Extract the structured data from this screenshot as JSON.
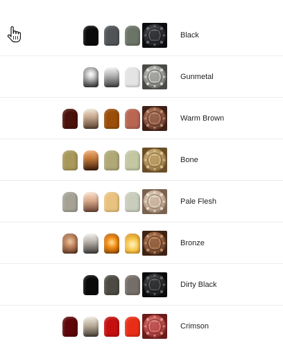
{
  "cursor": {
    "icon": "hand-pointer-icon"
  },
  "schemes": [
    {
      "name": "Black",
      "pots": [
        "#0b0b0b",
        "#505457",
        "#6b7467"
      ],
      "swatch": {
        "base": "#2b2d30",
        "light": "#7a7e84",
        "dark": "#0c0c0e"
      }
    },
    {
      "name": "Gunmetal",
      "pots": [
        "metallic-silver",
        "metallic-chrome",
        "#e4e4e4"
      ],
      "swatch": {
        "base": "#9a9a96",
        "light": "#ecece8",
        "dark": "#4a4a46"
      }
    },
    {
      "name": "Warm Brown",
      "pots": [
        "#4a120a",
        "tan-gradient",
        "#9a4e0a",
        "#b86552"
      ],
      "swatch": {
        "base": "#8e5a44",
        "light": "#d59c7e",
        "dark": "#3e2016"
      }
    },
    {
      "name": "Bone",
      "pots": [
        "#a8985a",
        "copper-gradient",
        "#b0a877",
        "#c3c7a2"
      ],
      "swatch": {
        "base": "#b4945e",
        "light": "#ead2a0",
        "dark": "#6a4e28"
      }
    },
    {
      "name": "Pale Flesh",
      "pots": [
        "#a5a295",
        "flesh-gradient",
        "#e9c27f",
        "#c9cdbb"
      ],
      "swatch": {
        "base": "#c8b09a",
        "light": "#f4ebdf",
        "dark": "#7a6250"
      }
    },
    {
      "name": "Bronze",
      "pots": [
        "bronze-gradient",
        "steel-gradient",
        "orange-gradient",
        "gold-gradient"
      ],
      "swatch": {
        "base": "#8e5c3c",
        "light": "#d8a278",
        "dark": "#3e2414"
      }
    },
    {
      "name": "Dirty Black",
      "pots": [
        "#0a0a0a",
        "#4c4a42",
        "#756e68"
      ],
      "swatch": {
        "base": "#2a2b2c",
        "light": "#76797c",
        "dark": "#0b0b0c"
      }
    },
    {
      "name": "Crimson",
      "pots": [
        "#5e0608",
        "sand-gradient",
        "#c4100e",
        "#e82e16"
      ],
      "swatch": {
        "base": "#b84a48",
        "light": "#f2a09a",
        "dark": "#6a1c1a"
      }
    }
  ]
}
